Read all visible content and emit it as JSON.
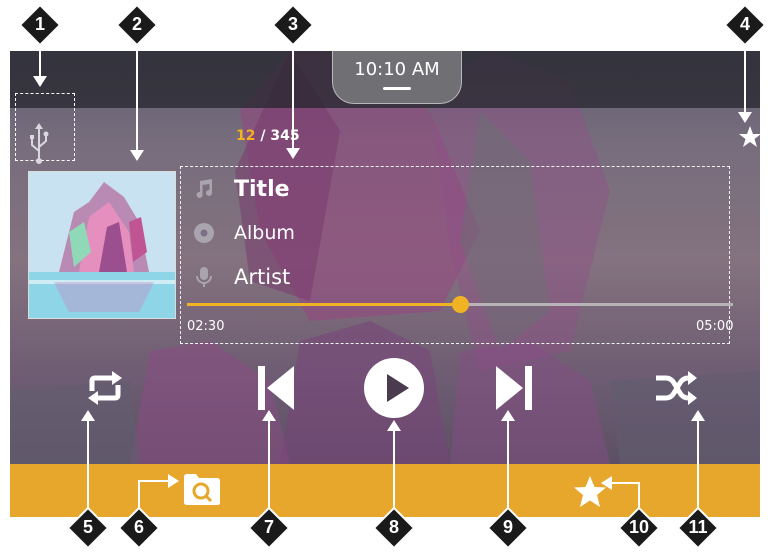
{
  "status_bar": {
    "clock": "10:10 AM"
  },
  "now_playing": {
    "track_index": "12",
    "track_total": "/ 345",
    "title": "Title",
    "album": "Album",
    "artist": "Artist",
    "elapsed": "02:30",
    "duration": "05:00",
    "progress_fraction": 0.5
  },
  "icons": {
    "source": "usb-icon",
    "favorite_top": "star-icon",
    "title": "music-note-icon",
    "album": "disc-icon",
    "artist": "microphone-icon",
    "repeat": "repeat-icon",
    "previous": "skip-previous-icon",
    "play": "play-icon",
    "next": "skip-next-icon",
    "shuffle": "shuffle-icon",
    "browse": "folder-search-icon",
    "favorites": "star-icon"
  },
  "callouts": [
    "1",
    "2",
    "3",
    "4",
    "5",
    "6",
    "7",
    "8",
    "9",
    "10",
    "11"
  ],
  "colors": {
    "accent": "#f0b324",
    "bottom_bar": "#e7a72c",
    "callout_badge": "#1a1a1a",
    "status_bar": "#28282f"
  }
}
